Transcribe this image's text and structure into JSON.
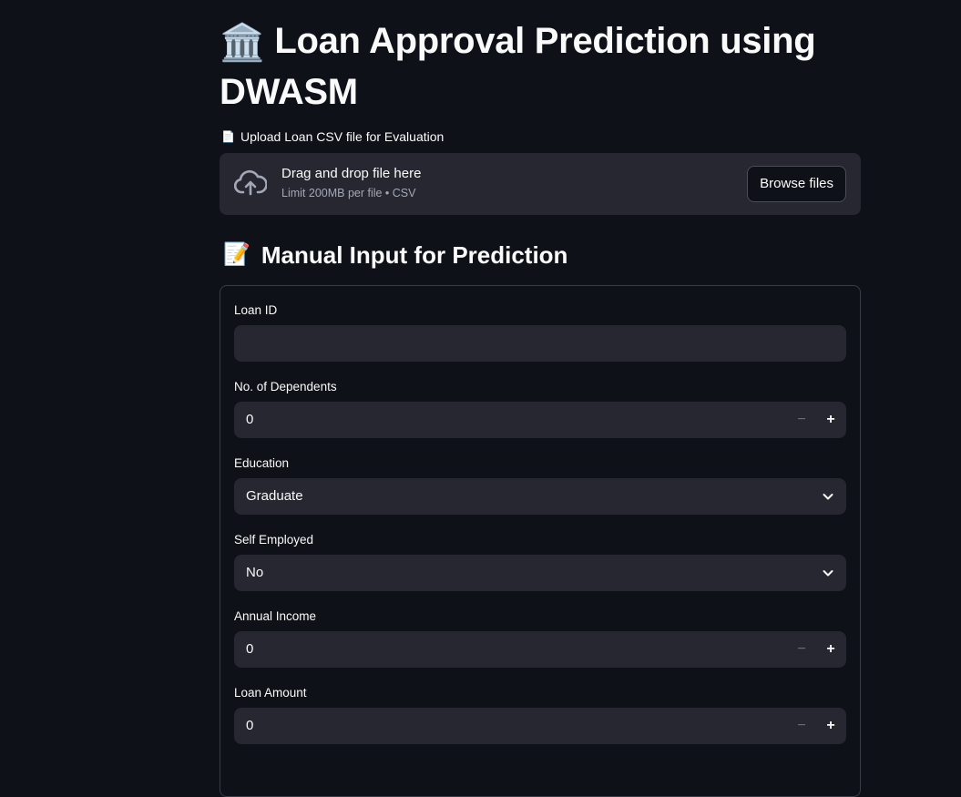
{
  "header": {
    "title_emoji": "🏛️",
    "title": "Loan Approval Prediction using DWASM"
  },
  "upload": {
    "label_emoji": "📄",
    "label": "Upload Loan CSV file for Evaluation",
    "drop_text": "Drag and drop file here",
    "limit_text": "Limit 200MB per file • CSV",
    "browse_label": "Browse files",
    "icon": "cloud-upload-icon"
  },
  "manual": {
    "section_emoji": "📝",
    "section_title": "Manual Input for Prediction",
    "fields": {
      "loan_id": {
        "label": "Loan ID",
        "value": ""
      },
      "dependents": {
        "label": "No. of Dependents",
        "value": "0"
      },
      "education": {
        "label": "Education",
        "value": "Graduate"
      },
      "self_employed": {
        "label": "Self Employed",
        "value": "No"
      },
      "annual_income": {
        "label": "Annual Income",
        "value": "0"
      },
      "loan_amount": {
        "label": "Loan Amount",
        "value": "0"
      }
    },
    "stepper": {
      "minus": "−",
      "plus": "+"
    }
  },
  "colors": {
    "background": "#0e1117",
    "widget": "#262730",
    "text": "#fafafa",
    "muted": "#a3a8b8"
  }
}
